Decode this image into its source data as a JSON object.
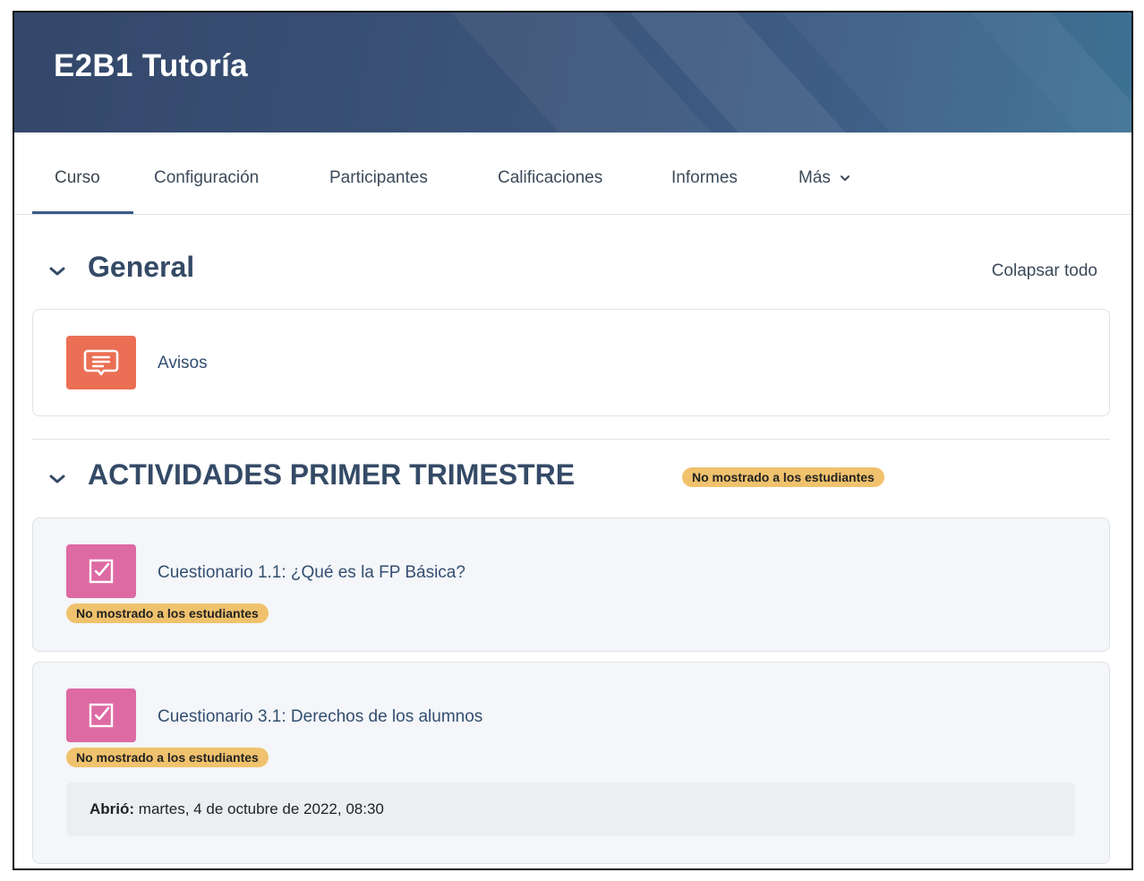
{
  "header": {
    "course_title": "E2B1 Tutoría"
  },
  "nav": {
    "tabs": [
      {
        "label": "Curso",
        "active": true
      },
      {
        "label": "Configuración"
      },
      {
        "label": "Participantes"
      },
      {
        "label": "Calificaciones"
      },
      {
        "label": "Informes"
      },
      {
        "label": "Más"
      }
    ]
  },
  "collapse_all_label": "Colapsar todo",
  "sections": [
    {
      "title": "General",
      "activities": [
        {
          "type": "forum",
          "icon": "forum-icon",
          "name": "Avisos"
        }
      ]
    },
    {
      "title": "ACTIVIDADES PRIMER TRIMESTRE",
      "badge": "No mostrado a los estudiantes",
      "activities": [
        {
          "type": "quiz",
          "icon": "quiz-icon",
          "name": "Cuestionario 1.1: ¿Qué es la FP Básica?",
          "badge": "No mostrado a los estudiantes"
        },
        {
          "type": "quiz",
          "icon": "quiz-icon",
          "name": "Cuestionario 3.1: Derechos de los alumnos",
          "badge": "No mostrado a los estudiantes",
          "dates": {
            "label": "Abrió:",
            "value": "martes, 4 de octubre de 2022, 08:30"
          }
        }
      ]
    }
  ],
  "colors": {
    "banner": "#3b5378",
    "forum_icon_bg": "#eb6f55",
    "quiz_icon_bg": "#dd6aa3",
    "badge_bg": "#f0c26d",
    "section_title": "#344a66"
  }
}
